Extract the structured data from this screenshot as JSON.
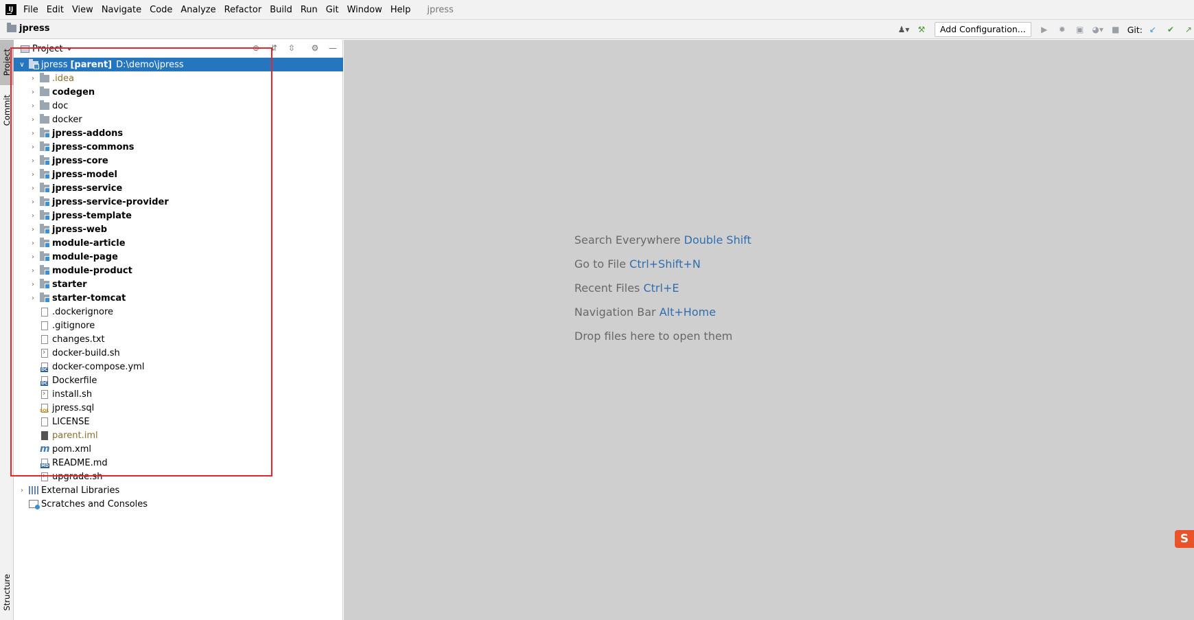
{
  "window": {
    "project_title": "jpress"
  },
  "menu": [
    "File",
    "Edit",
    "View",
    "Navigate",
    "Code",
    "Analyze",
    "Refactor",
    "Build",
    "Run",
    "Git",
    "Window",
    "Help"
  ],
  "navbar": {
    "breadcrumb": "jpress",
    "add_config_label": "Add Configuration...",
    "git_label": "Git:"
  },
  "stripe": {
    "project": "Project",
    "commit": "Commit",
    "structure": "Structure"
  },
  "panel": {
    "view_label": "Project"
  },
  "tree": {
    "root": {
      "name": "jpress",
      "tag": "[parent]",
      "path": "D:\\demo\\jpress"
    },
    "folders": [
      {
        "name": ".idea",
        "style": "excluded",
        "module": false
      },
      {
        "name": "codegen",
        "style": "bold",
        "module": false
      },
      {
        "name": "doc",
        "style": "normal",
        "module": false
      },
      {
        "name": "docker",
        "style": "normal",
        "module": false
      },
      {
        "name": "jpress-addons",
        "style": "bold",
        "module": true
      },
      {
        "name": "jpress-commons",
        "style": "bold",
        "module": true
      },
      {
        "name": "jpress-core",
        "style": "bold",
        "module": true
      },
      {
        "name": "jpress-model",
        "style": "bold",
        "module": true
      },
      {
        "name": "jpress-service",
        "style": "bold",
        "module": true
      },
      {
        "name": "jpress-service-provider",
        "style": "bold",
        "module": true
      },
      {
        "name": "jpress-template",
        "style": "bold",
        "module": true
      },
      {
        "name": "jpress-web",
        "style": "bold",
        "module": true
      },
      {
        "name": "module-article",
        "style": "bold",
        "module": true
      },
      {
        "name": "module-page",
        "style": "bold",
        "module": true
      },
      {
        "name": "module-product",
        "style": "bold",
        "module": true
      },
      {
        "name": "starter",
        "style": "bold",
        "module": true
      },
      {
        "name": "starter-tomcat",
        "style": "bold",
        "module": true
      }
    ],
    "files": [
      {
        "name": ".dockerignore",
        "icon": "text"
      },
      {
        "name": ".gitignore",
        "icon": "text"
      },
      {
        "name": "changes.txt",
        "icon": "text"
      },
      {
        "name": "docker-build.sh",
        "icon": "shell"
      },
      {
        "name": "docker-compose.yml",
        "icon": "docker-compose"
      },
      {
        "name": "Dockerfile",
        "icon": "docker"
      },
      {
        "name": "install.sh",
        "icon": "shell"
      },
      {
        "name": "jpress.sql",
        "icon": "sql"
      },
      {
        "name": "LICENSE",
        "icon": "text"
      },
      {
        "name": "parent.iml",
        "icon": "iml"
      },
      {
        "name": "pom.xml",
        "icon": "maven"
      },
      {
        "name": "README.md",
        "icon": "markdown"
      },
      {
        "name": "upgrade.sh",
        "icon": "shell"
      }
    ],
    "external_libraries": "External Libraries",
    "scratches": "Scratches and Consoles"
  },
  "editor_hints": [
    {
      "text": "Search Everywhere",
      "key": "Double Shift"
    },
    {
      "text": "Go to File",
      "key": "Ctrl+Shift+N"
    },
    {
      "text": "Recent Files",
      "key": "Ctrl+E"
    },
    {
      "text": "Navigation Bar",
      "key": "Alt+Home"
    },
    {
      "text": "Drop files here to open them",
      "key": ""
    }
  ],
  "ime_badge": "S",
  "colors": {
    "selection": "#2675bf",
    "highlight_box": "#e8232a",
    "editor_bg": "#cfcfcf",
    "shortcut": "#2f6eae"
  }
}
